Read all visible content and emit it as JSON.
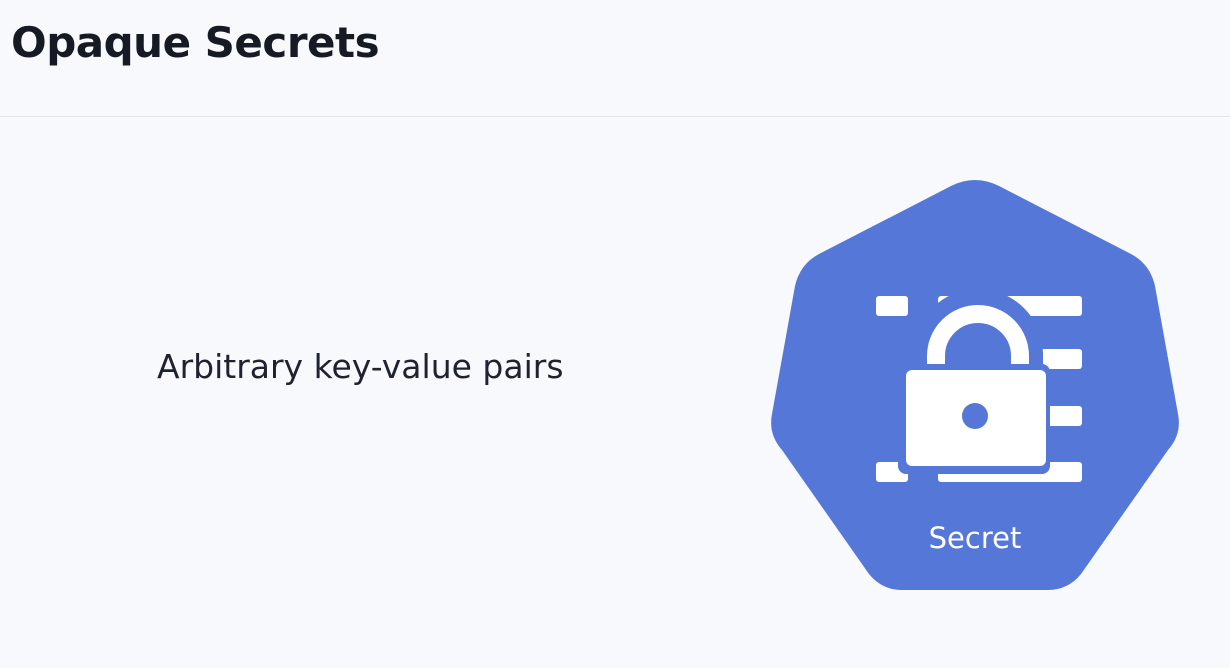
{
  "header": {
    "title": "Opaque Secrets"
  },
  "main": {
    "description": "Arbitrary key-value pairs",
    "resource_icon": {
      "icon": "secret-icon",
      "label": "Secret",
      "color": "#5577d7"
    }
  },
  "colors": {
    "background": "#f8f9fc",
    "divider": "#e3e5ea",
    "text": "#161a24",
    "icon_fill": "#5577d7",
    "icon_foreground": "#ffffff"
  }
}
